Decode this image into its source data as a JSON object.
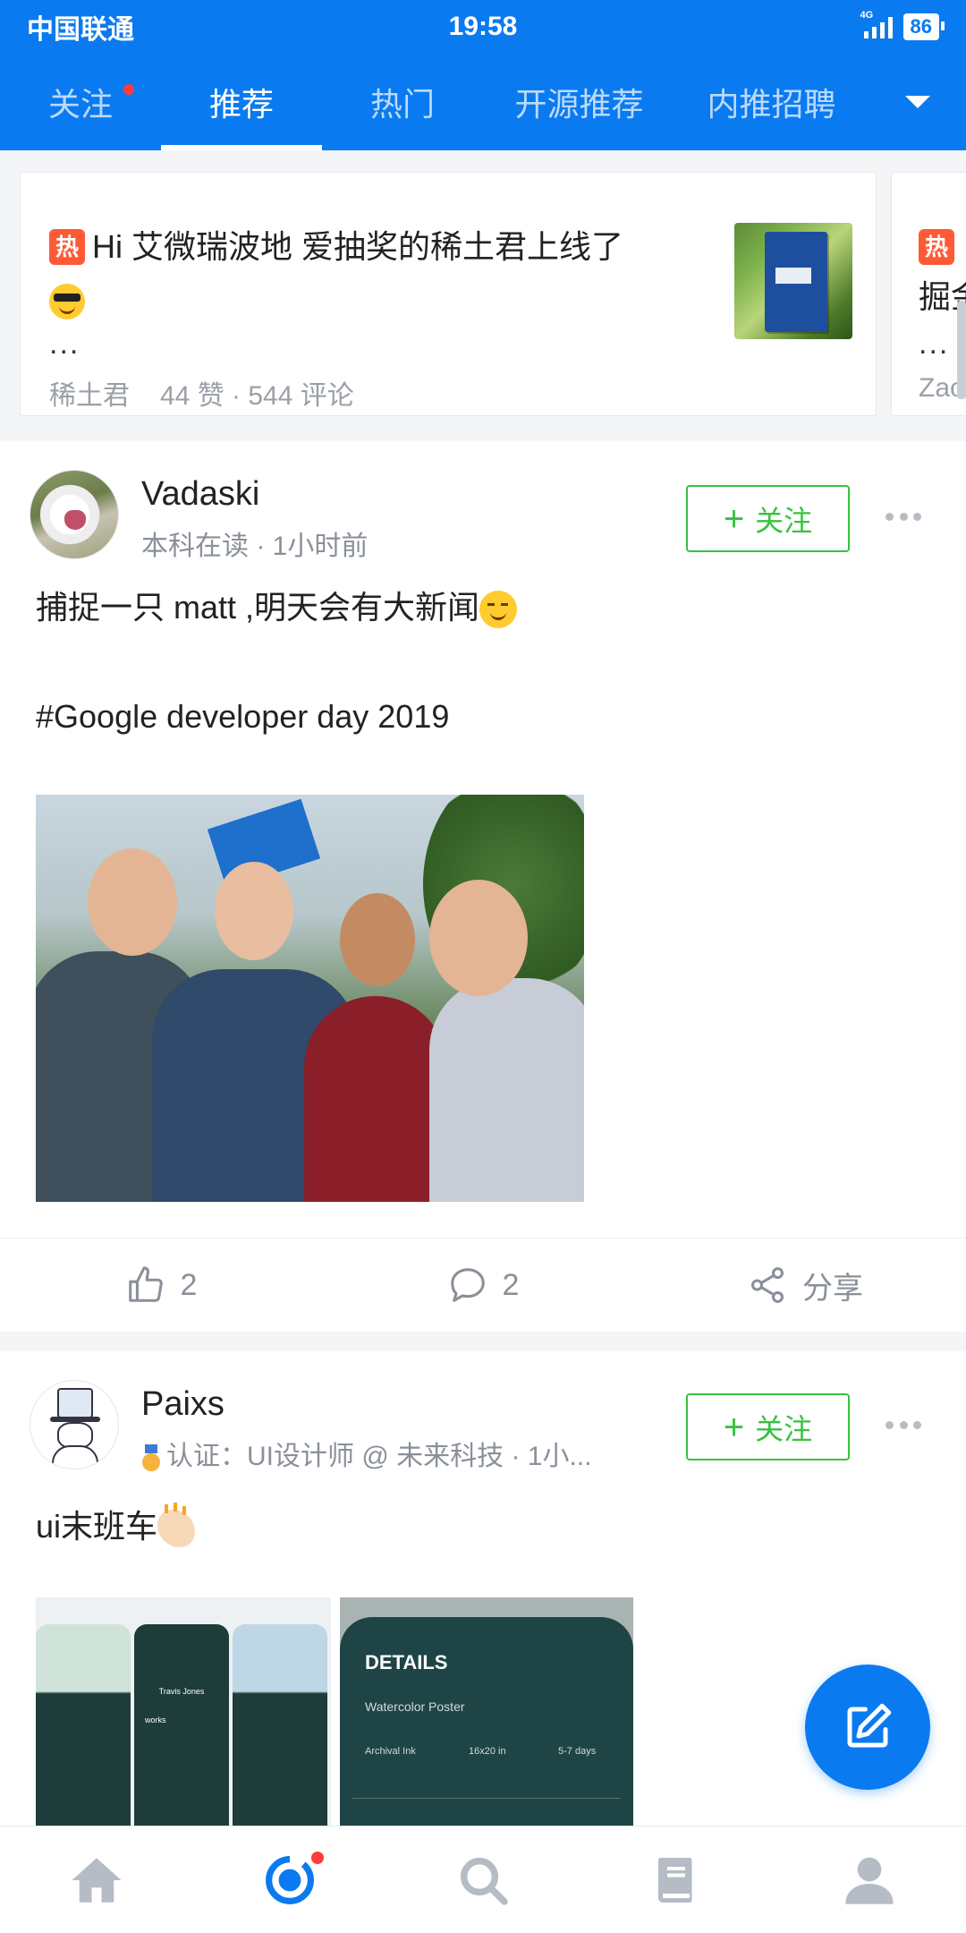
{
  "status_bar": {
    "carrier": "中国联通",
    "time": "19:58",
    "network": "4G",
    "battery": "86"
  },
  "tabs": [
    {
      "label": "关注",
      "has_dot": true
    },
    {
      "label": "推荐",
      "active": true
    },
    {
      "label": "热门"
    },
    {
      "label": "开源推荐"
    },
    {
      "label": "内推招聘"
    }
  ],
  "hot": {
    "badge": "热",
    "title": "Hi 艾微瑞波地 爱抽奖的稀土君上线了",
    "ellipsis": "...",
    "author": "稀土君",
    "stats": "44 赞 · 544 评论",
    "next_badge": "热",
    "next_title": "掘金",
    "next_ellipsis": "...",
    "next_author": "Zac"
  },
  "posts": [
    {
      "username": "Vadaski",
      "subtitle": "本科在读 · 1小时前",
      "follow_label": "关注",
      "text_line1": "捕捉一只 matt ,明天会有大新闻",
      "text_line2": "#Google developer day 2019",
      "likes": "2",
      "comments": "2",
      "share_label": "分享"
    },
    {
      "username": "Paixs",
      "subtitle": "认证：UI设计师 @ 未来科技 · 1小...",
      "follow_label": "关注",
      "text_line1": "ui末班车",
      "shot_app_name": "Travis Jones",
      "shot_app_section": "works",
      "shot_detail_title": "DETAILS",
      "shot_detail_sub": "Watercolor Poster",
      "shot_detail_a": "Archival Ink",
      "shot_detail_b": "16x20 in",
      "shot_detail_c": "5-7 days"
    }
  ],
  "colors": {
    "brand_blue": "#0a7af0",
    "follow_green": "#37c23e",
    "hot_red": "#ff5a36",
    "dot_red": "#ff3b3b"
  },
  "bottom_nav": [
    "home-icon",
    "discover-icon",
    "search-icon",
    "book-icon",
    "profile-icon"
  ]
}
